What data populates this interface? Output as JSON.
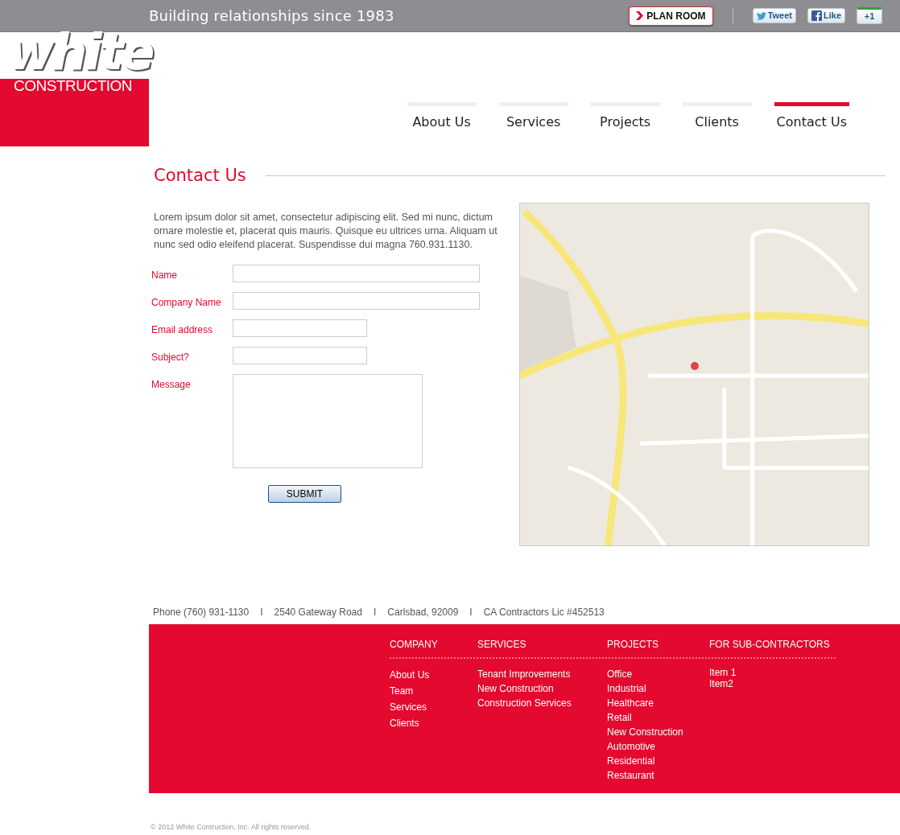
{
  "top_bar": {
    "tagline": "Building relationships since 1983",
    "plan_room": "PLAN ROOM",
    "social": [
      {
        "kind": "tweet",
        "label": "Tweet"
      },
      {
        "kind": "like",
        "label": "Like"
      },
      {
        "kind": "plusone",
        "label": "+1"
      }
    ]
  },
  "logo": {
    "word": "white",
    "subtitle": "CONSTRUCTION"
  },
  "nav": [
    {
      "label": "About Us",
      "selected": false
    },
    {
      "label": "Services",
      "selected": false
    },
    {
      "label": "Projects",
      "selected": false
    },
    {
      "label": "Clients",
      "selected": false
    },
    {
      "label": "Contact Us",
      "selected": true
    }
  ],
  "page": {
    "title": "Contact Us",
    "intro": "Lorem ipsum dolor sit amet, consectetur adipiscing elit. Sed mi nunc, dictum ornare molestie et, placerat quis mauris. Quisque eu ultrices urna. Aliquam ut nunc sed odio eleifend placerat. Suspendisse dui magna 760.931.1130.",
    "fields": [
      {
        "label": "Name",
        "kind": "long"
      },
      {
        "label": "Company Name",
        "kind": "long"
      },
      {
        "label": "Email address",
        "kind": "short"
      },
      {
        "label": "Subject?",
        "kind": "short"
      },
      {
        "label": "Message",
        "kind": "area"
      }
    ],
    "submit": "SUBMIT"
  },
  "contact_line": [
    {
      "text": "Phone (760) 931-1130",
      "separator": "I"
    },
    {
      "text": "2540 Gateway Road",
      "separator": "I"
    },
    {
      "text": "Carlsbad, 92009",
      "separator": "I"
    },
    {
      "text": "CA Contractors Lic #452513"
    }
  ],
  "footer_columns": [
    {
      "heading": "COMPANY",
      "links": [
        "About Us",
        "Team",
        "Services",
        "Clients"
      ]
    },
    {
      "heading": "SERVICES",
      "links": [
        "Tenant Improvements",
        "New Construction",
        "Construction Services"
      ]
    },
    {
      "heading": "PROJECTS",
      "links": [
        "Office",
        "Industrial",
        "Healthcare",
        "Retail",
        "New Construction",
        "Automotive",
        "Residential",
        "Restaurant"
      ]
    },
    {
      "heading": "FOR SUB-CONTRACTORS",
      "links": [
        "Item 1",
        "Item2"
      ]
    }
  ],
  "copyright": "© 2012 White Contruction, Inc. All rights reserved."
}
